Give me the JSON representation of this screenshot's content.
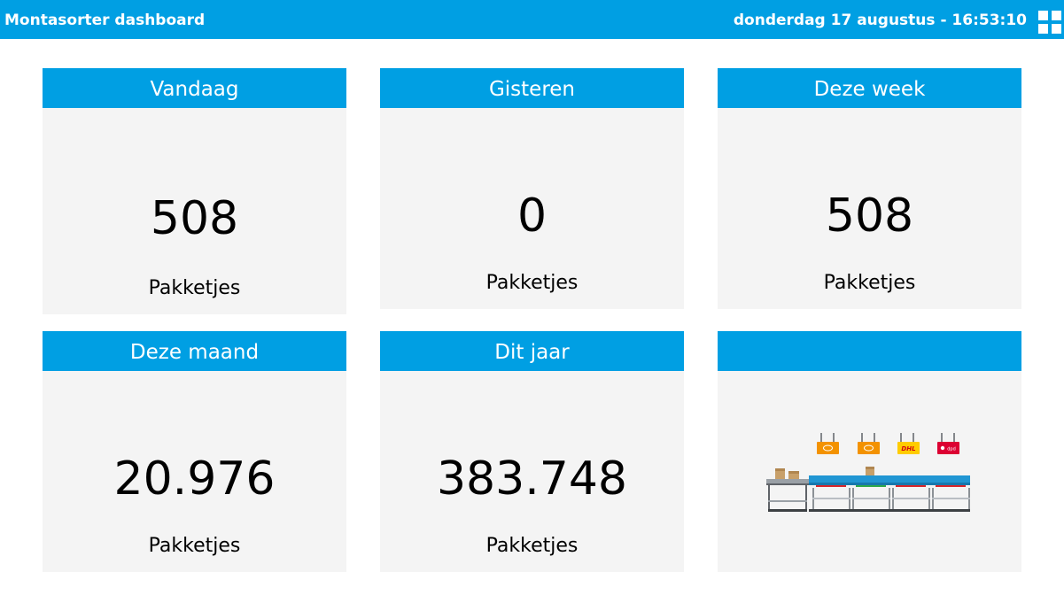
{
  "header": {
    "title": "Montasorter dashboard",
    "datetime": "donderdag 17 augustus - 16:53:10",
    "menu_icon": "grid-icon"
  },
  "cards": [
    {
      "title": "Vandaag",
      "value": "508",
      "unit": "Pakketjes"
    },
    {
      "title": "Gisteren",
      "value": "0",
      "unit": "Pakketjes"
    },
    {
      "title": "Deze week",
      "value": "508",
      "unit": "Pakketjes"
    },
    {
      "title": "Deze maand",
      "value": "20.976",
      "unit": "Pakketjes"
    },
    {
      "title": "Dit jaar",
      "value": "383.748",
      "unit": "Pakketjes"
    },
    {
      "title": "",
      "illustration": "parcel-sorter-illustration"
    }
  ],
  "illustration": {
    "carrier_labels": [
      "DHL",
      "dpd"
    ]
  },
  "colors": {
    "accent": "#009fe3",
    "card_background": "#f4f4f4",
    "postnl_orange": "#f39200",
    "dhl_yellow": "#ffcc00",
    "dpd_red": "#dc0032"
  }
}
